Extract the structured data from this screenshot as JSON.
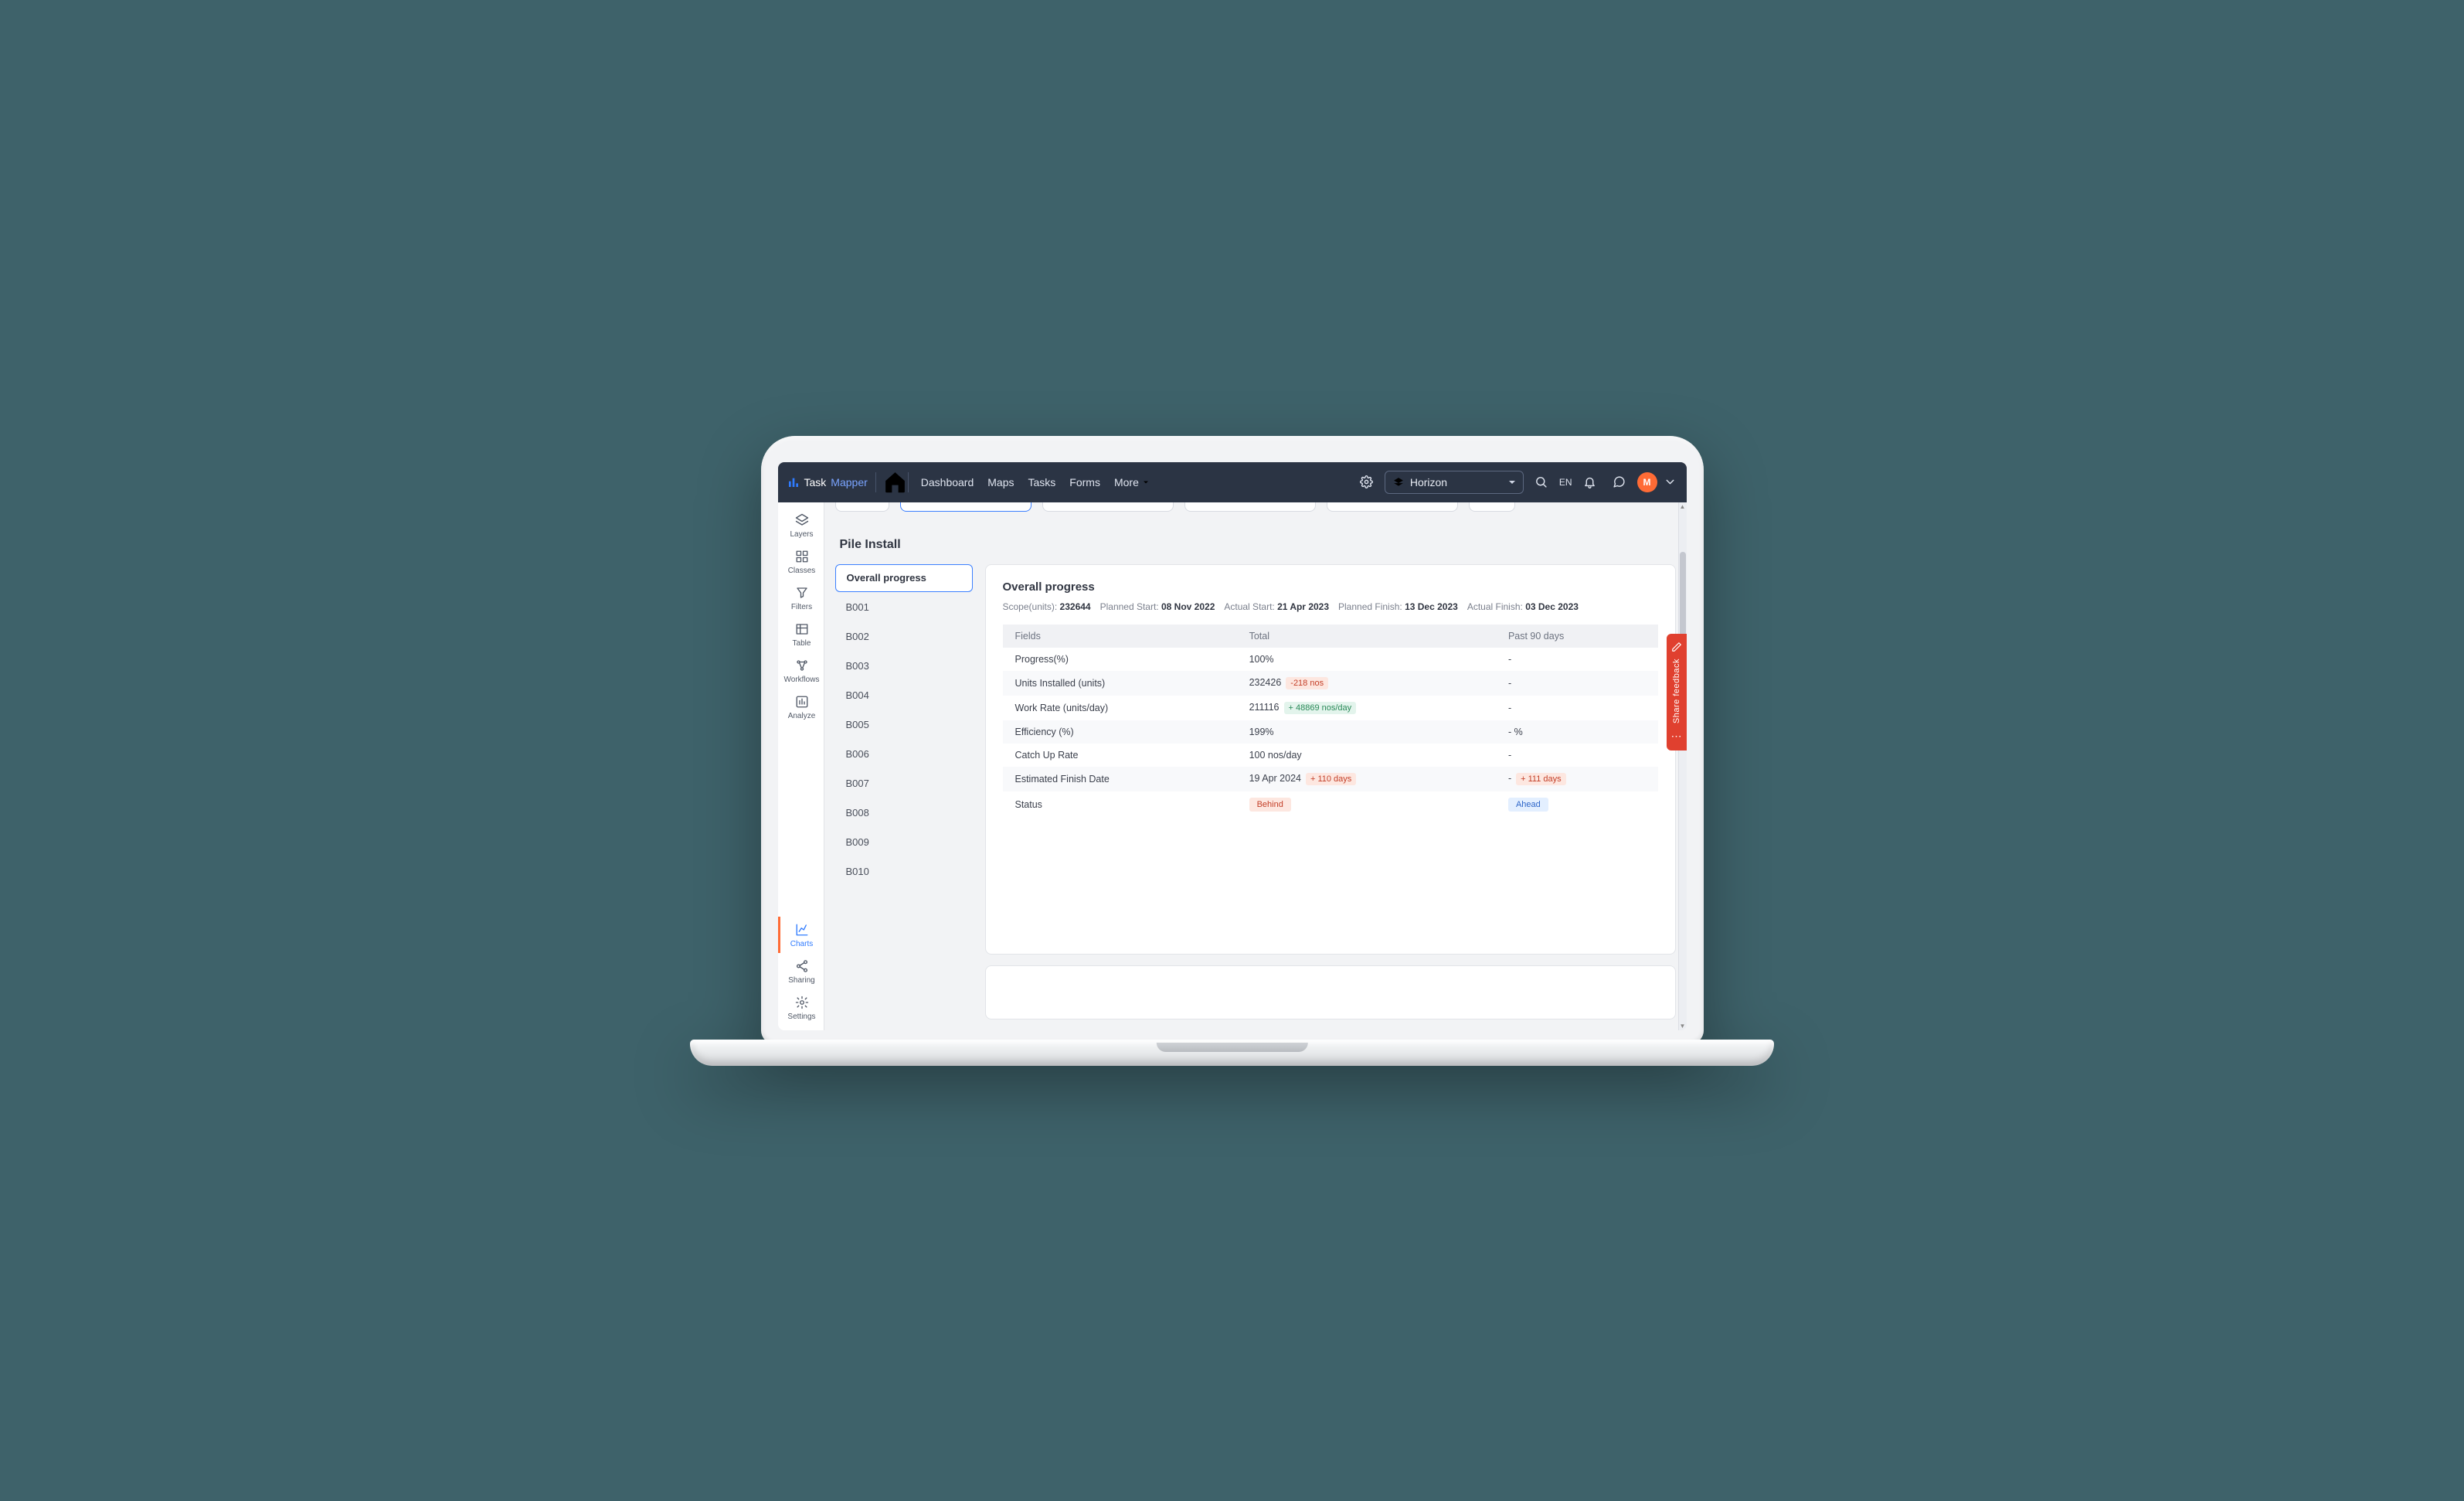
{
  "brand": {
    "name": "Task",
    "suffix": "Mapper"
  },
  "nav": {
    "items": [
      "Dashboard",
      "Maps",
      "Tasks",
      "Forms"
    ],
    "more": "More"
  },
  "topbar": {
    "project": "Horizon",
    "lang": "EN",
    "avatar": "M"
  },
  "leftrail": [
    {
      "id": "layers",
      "label": "Layers"
    },
    {
      "id": "classes",
      "label": "Classes"
    },
    {
      "id": "filters",
      "label": "Filters"
    },
    {
      "id": "table",
      "label": "Table"
    },
    {
      "id": "workflows",
      "label": "Workflows"
    },
    {
      "id": "analyze",
      "label": "Analyze"
    },
    {
      "id": "charts",
      "label": "Charts",
      "active": true
    },
    {
      "id": "sharing",
      "label": "Sharing"
    },
    {
      "id": "settings",
      "label": "Settings"
    }
  ],
  "section_title": "Pile Install",
  "sidelist": {
    "active": "Overall progress",
    "items": [
      "Overall progress",
      "B001",
      "B002",
      "B003",
      "B004",
      "B005",
      "B006",
      "B007",
      "B008",
      "B009",
      "B010"
    ]
  },
  "panel": {
    "title": "Overall progress",
    "meta": [
      {
        "label": "Scope(units)",
        "value": "232644"
      },
      {
        "label": "Planned Start",
        "value": "08 Nov 2022"
      },
      {
        "label": "Actual Start",
        "value": "21 Apr 2023"
      },
      {
        "label": "Planned Finish",
        "value": "13 Dec 2023"
      },
      {
        "label": "Actual Finish",
        "value": "03 Dec 2023"
      }
    ],
    "columns": [
      "Fields",
      "Total",
      "Past 90 days"
    ],
    "rows": [
      {
        "f": "Progress(%)",
        "total": "100%",
        "p90": "-"
      },
      {
        "f": "Units Installed (units)",
        "total": "232426",
        "total_pill": "-218 nos",
        "tp": "red",
        "p90": "-"
      },
      {
        "f": "Work Rate (units/day)",
        "total": "211116",
        "total_pill": "+ 48869 nos/day",
        "tp": "green",
        "p90": "-"
      },
      {
        "f": "Efficiency (%)",
        "total": "199%",
        "p90": "- %"
      },
      {
        "f": "Catch Up Rate",
        "total": "100 nos/day",
        "p90": "-"
      },
      {
        "f": "Estimated Finish Date",
        "total": "19 Apr 2024",
        "total_pill": "+ 110 days",
        "tp": "red",
        "p90": "-",
        "p90_pill": "+ 111 days",
        "pp": "red"
      },
      {
        "f": "Status",
        "status_total": "Behind",
        "status_p90": "Ahead"
      }
    ]
  },
  "feedback_label": "Share feedback"
}
